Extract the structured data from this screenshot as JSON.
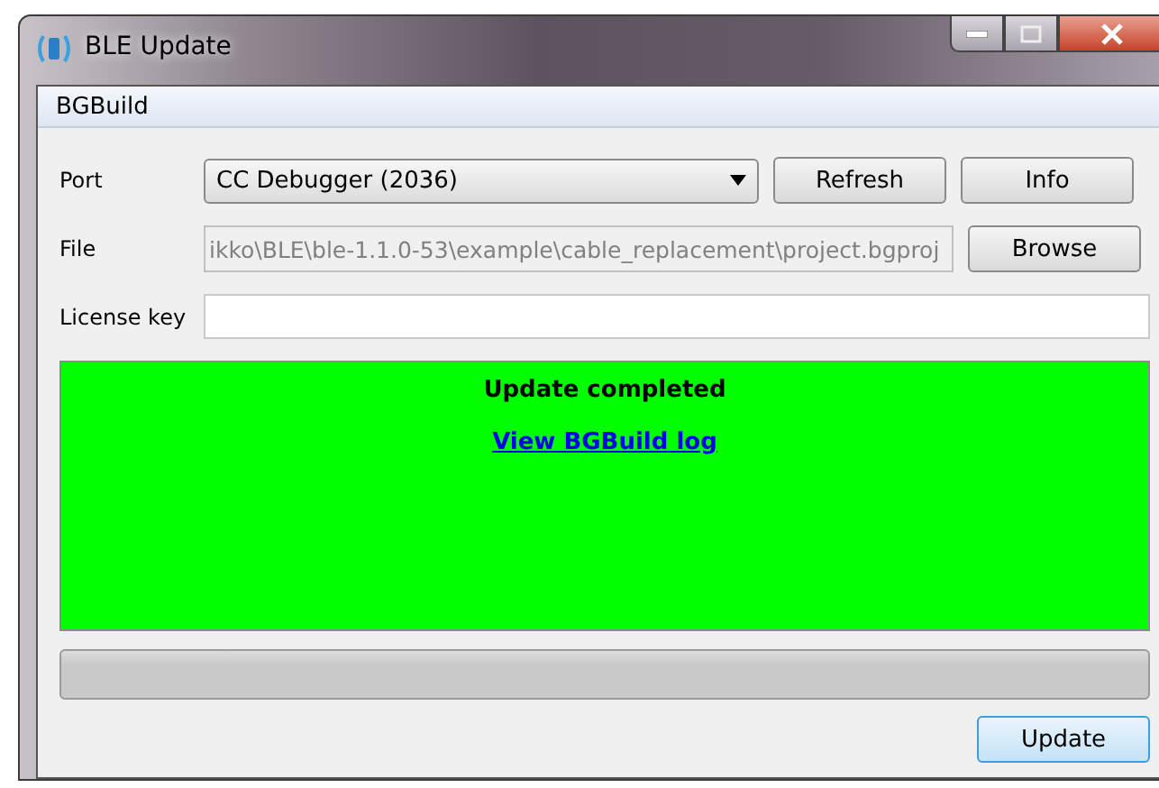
{
  "window": {
    "title": "BLE Update"
  },
  "menu": [
    "BGBuild"
  ],
  "port": {
    "label": "Port",
    "value": "CC Debugger (2036)"
  },
  "buttons_top": [
    "Refresh",
    "Info"
  ],
  "file": {
    "label": "File",
    "value": "ikko\\BLE\\ble-1.1.0-53\\example\\cable_replacement\\project.bgproj",
    "disabled": true
  },
  "browse": "Browse",
  "license": {
    "label": "License key"
  },
  "status": {
    "message": "Update completed",
    "link": "View BGBuild log",
    "color": "#00ff00"
  },
  "progress": {
    "level": 0
  },
  "update_button": "Update"
}
